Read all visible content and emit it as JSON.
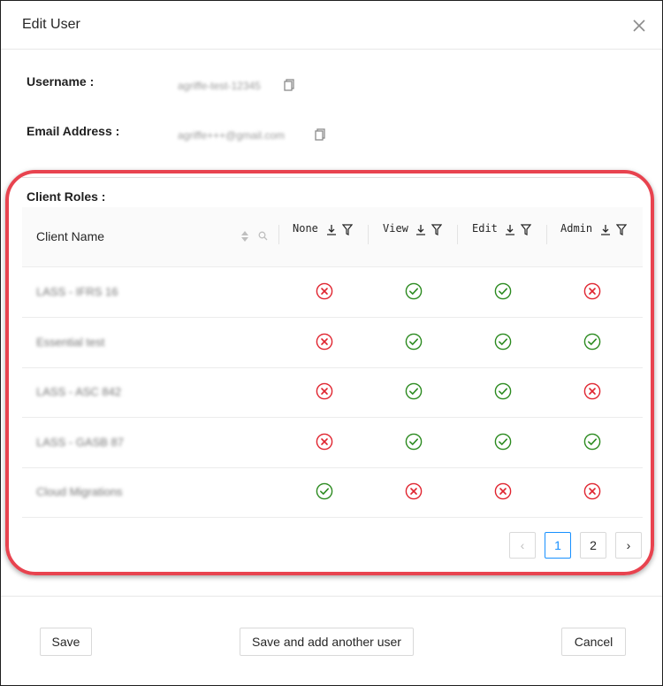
{
  "modal": {
    "title": "Edit User",
    "close_icon": "close-icon"
  },
  "fields": {
    "username_label": "Username :",
    "username_value": "agriffe-test-12345",
    "email_label": "Email Address :",
    "email_value": "agriffe+++@gmail.com"
  },
  "client_roles": {
    "title": "Client Roles :",
    "columns": {
      "client": "Client Name",
      "roles": [
        "None",
        "View",
        "Edit",
        "Admin"
      ]
    },
    "rows": [
      {
        "name": "LASS - IFRS 16",
        "none": false,
        "view": true,
        "edit": true,
        "admin": false
      },
      {
        "name": "Essential test",
        "none": false,
        "view": true,
        "edit": true,
        "admin": true
      },
      {
        "name": "LASS - ASC 842",
        "none": false,
        "view": true,
        "edit": true,
        "admin": false
      },
      {
        "name": "LASS - GASB 87",
        "none": false,
        "view": true,
        "edit": true,
        "admin": true
      },
      {
        "name": "Cloud Migrations",
        "none": true,
        "view": false,
        "edit": false,
        "admin": false
      }
    ]
  },
  "pagination": {
    "prev": "‹",
    "pages": [
      "1",
      "2"
    ],
    "current": "1",
    "next": "›"
  },
  "footer": {
    "save": "Save",
    "save_add": "Save and add another user",
    "cancel": "Cancel"
  },
  "colors": {
    "check": "#2b8a1f",
    "cross": "#e0242f",
    "highlight": "#e8434f",
    "primary": "#1890ff"
  }
}
